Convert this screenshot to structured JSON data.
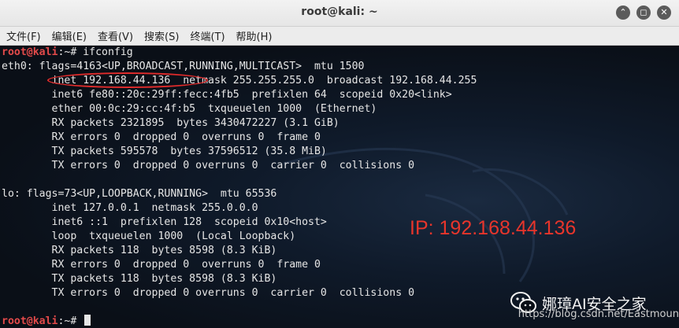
{
  "window": {
    "title": "root@kali: ~",
    "controls": {
      "minimize": "⌃",
      "maximize": "◻",
      "close": "✕"
    }
  },
  "menubar": {
    "items": [
      "文件(F)",
      "编辑(E)",
      "查看(V)",
      "搜索(S)",
      "终端(T)",
      "帮助(H)"
    ]
  },
  "terminal": {
    "prompt_user": "root@kali",
    "prompt_path": ":~# ",
    "command": "ifconfig",
    "lines": [
      "eth0: flags=4163<UP,BROADCAST,RUNNING,MULTICAST>  mtu 1500",
      "        inet 192.168.44.136  netmask 255.255.255.0  broadcast 192.168.44.255",
      "        inet6 fe80::20c:29ff:fecc:4fb5  prefixlen 64  scopeid 0x20<link>",
      "        ether 00:0c:29:cc:4f:b5  txqueuelen 1000  (Ethernet)",
      "        RX packets 2321895  bytes 3430472227 (3.1 GiB)",
      "        RX errors 0  dropped 0  overruns 0  frame 0",
      "        TX packets 595578  bytes 37596512 (35.8 MiB)",
      "        TX errors 0  dropped 0 overruns 0  carrier 0  collisions 0",
      "",
      "lo: flags=73<UP,LOOPBACK,RUNNING>  mtu 65536",
      "        inet 127.0.0.1  netmask 255.0.0.0",
      "        inet6 ::1  prefixlen 128  scopeid 0x10<host>",
      "        loop  txqueuelen 1000  (Local Loopback)",
      "        RX packets 118  bytes 8598 (8.3 KiB)",
      "        RX errors 0  dropped 0  overruns 0  frame 0",
      "        TX packets 118  bytes 8598 (8.3 KiB)",
      "        TX errors 0  dropped 0 overruns 0  carrier 0  collisions 0",
      ""
    ],
    "final_prompt_path": ":~# "
  },
  "annotation": {
    "text": "IP: 192.168.44.136",
    "color": "#e8352b"
  },
  "watermark": {
    "brand": "娜璋AI安全之家",
    "url": "https://blog.csdn.net/Eastmoun",
    "icon": "wechat-icon"
  },
  "colors": {
    "prompt": "#e24a4a",
    "text": "#e6e6e6",
    "highlight": "#e02b2b"
  }
}
